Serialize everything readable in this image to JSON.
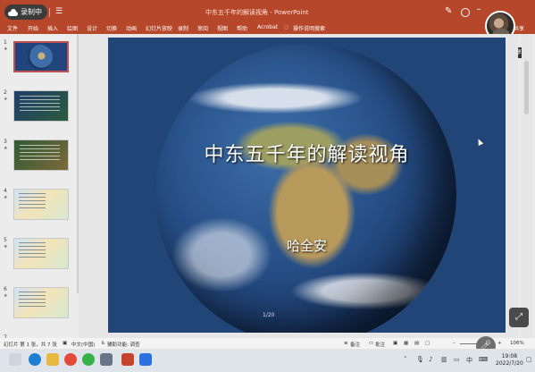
{
  "titlebar": {
    "recording": "录制中",
    "window_title": "中东五千年的解读视角  -  PowerPoint",
    "share": "共享"
  },
  "menu": [
    "文件",
    "开始",
    "插入",
    "绘图",
    "设计",
    "切换",
    "动画",
    "幻灯片放映",
    "录制",
    "审阅",
    "视图",
    "帮助",
    "Acrobat",
    "操作说明搜索"
  ],
  "participant": {
    "screen_label": "哈全安的屏幕共享"
  },
  "thumbnails": [
    {
      "num": "1",
      "style": "globe",
      "active": true
    },
    {
      "num": "2",
      "style": "dark",
      "active": false
    },
    {
      "num": "3",
      "style": "green",
      "active": false
    },
    {
      "num": "4",
      "style": "map",
      "active": false
    },
    {
      "num": "5",
      "style": "map",
      "active": false
    },
    {
      "num": "6",
      "style": "map",
      "active": false
    },
    {
      "num": "7",
      "style": "dark",
      "active": false
    }
  ],
  "slide": {
    "title": "中东五千年的解读视角",
    "author": "哈全安",
    "page_indicator": "1/20"
  },
  "status": {
    "slide_info": "幻灯片 第 1 张，共 7 张",
    "language": "中文(中国)",
    "accessibility": "辅助功能: 调查",
    "notes": "备注",
    "comments": "批注",
    "zoom": "106%"
  },
  "clock": {
    "time": "19:08",
    "date": "2022/7/20"
  },
  "tray": {
    "ime": "中"
  }
}
